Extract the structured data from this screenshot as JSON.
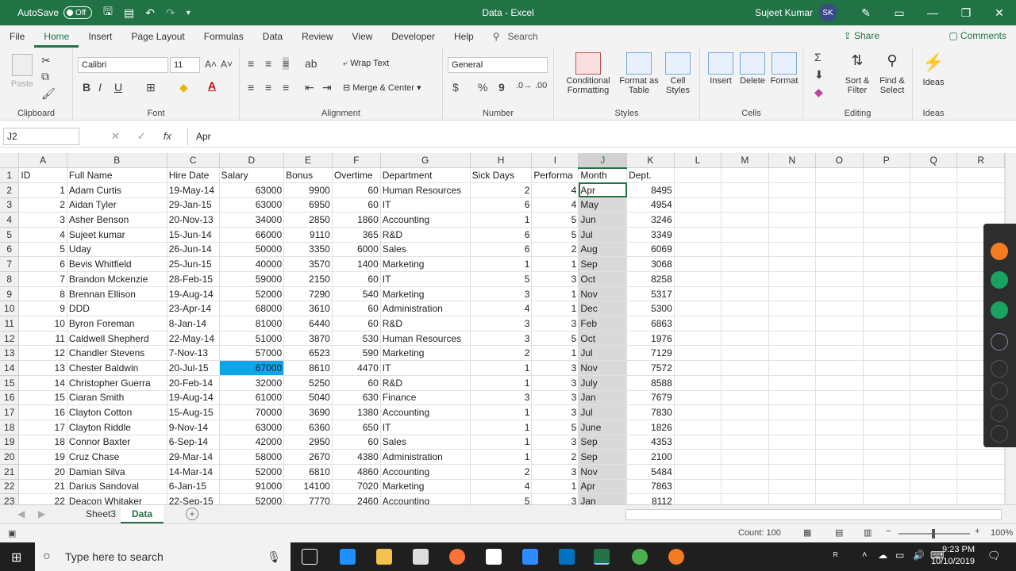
{
  "titlebar": {
    "autosave_label": "AutoSave",
    "autosave_state": "Off",
    "title": "Data - Excel",
    "user_name": "Sujeet Kumar",
    "user_initials": "SK"
  },
  "tabs": [
    "File",
    "Home",
    "Insert",
    "Page Layout",
    "Formulas",
    "Data",
    "Review",
    "View",
    "Developer",
    "Help"
  ],
  "active_tab": "Home",
  "search_label": "Search",
  "share_label": "Share",
  "comments_label": "Comments",
  "ribbon": {
    "clipboard": {
      "paste": "Paste",
      "label": "Clipboard"
    },
    "font": {
      "name": "Calibri",
      "size": "11",
      "bold": "B",
      "italic": "I",
      "underline": "U",
      "label": "Font"
    },
    "alignment": {
      "wrap": "Wrap Text",
      "merge": "Merge & Center",
      "label": "Alignment"
    },
    "number": {
      "format": "General",
      "currency": "$",
      "percent": "%",
      "comma": "9",
      "label": "Number"
    },
    "styles": {
      "conditional": "Conditional",
      "conditional2": "Formatting",
      "format_as": "Format as",
      "format_as2": "Table",
      "cell": "Cell",
      "cell2": "Styles",
      "label": "Styles"
    },
    "cells": {
      "insert": "Insert",
      "delete": "Delete",
      "format": "Format",
      "label": "Cells"
    },
    "editing": {
      "sort": "Sort &",
      "sort2": "Filter",
      "find": "Find &",
      "find2": "Select",
      "label": "Editing"
    },
    "ideas": {
      "ideas": "Ideas",
      "label": "Ideas"
    }
  },
  "formula_bar": {
    "name_box": "J2",
    "fx": "fx",
    "value": "Apr"
  },
  "columns": [
    "A",
    "B",
    "C",
    "D",
    "E",
    "F",
    "G",
    "H",
    "I",
    "J",
    "K",
    "L",
    "M",
    "N",
    "O",
    "P",
    "Q",
    "R"
  ],
  "headers": [
    "ID",
    "Full Name",
    "Hire Date",
    "Salary",
    "Bonus",
    "Overtime",
    "Department",
    "Sick Days",
    "Performa",
    "Month",
    "Dept."
  ],
  "rows": [
    [
      "1",
      "Adam Curtis",
      "19-May-14",
      "63000",
      "9900",
      "60",
      "Human Resources",
      "2",
      "4",
      "Apr",
      "8495"
    ],
    [
      "2",
      "Aidan Tyler",
      "29-Jan-15",
      "63000",
      "6950",
      "60",
      "IT",
      "6",
      "4",
      "May",
      "4954"
    ],
    [
      "3",
      "Asher Benson",
      "20-Nov-13",
      "34000",
      "2850",
      "1860",
      "Accounting",
      "1",
      "5",
      "Jun",
      "3246"
    ],
    [
      "4",
      "Sujeet kumar",
      "15-Jun-14",
      "66000",
      "9110",
      "365",
      "R&D",
      "6",
      "5",
      "Jul",
      "3349"
    ],
    [
      "5",
      "Uday",
      "26-Jun-14",
      "50000",
      "3350",
      "6000",
      "Sales",
      "6",
      "2",
      "Aug",
      "6069"
    ],
    [
      "6",
      "Bevis Whitfield",
      "25-Jun-15",
      "40000",
      "3570",
      "1400",
      "Marketing",
      "1",
      "1",
      "Sep",
      "3068"
    ],
    [
      "7",
      "Brandon Mckenzie",
      "28-Feb-15",
      "59000",
      "2150",
      "60",
      "IT",
      "5",
      "3",
      "Oct",
      "8258"
    ],
    [
      "8",
      "Brennan Ellison",
      "19-Aug-14",
      "52000",
      "7290",
      "540",
      "Marketing",
      "3",
      "1",
      "Nov",
      "5317"
    ],
    [
      "9",
      "DDD",
      "23-Apr-14",
      "68000",
      "3610",
      "60",
      "Administration",
      "4",
      "1",
      "Dec",
      "5300"
    ],
    [
      "10",
      "Byron Foreman",
      "8-Jan-14",
      "81000",
      "6440",
      "60",
      "R&D",
      "3",
      "3",
      "Feb",
      "6863"
    ],
    [
      "11",
      "Caldwell Shepherd",
      "22-May-14",
      "51000",
      "3870",
      "530",
      "Human Resources",
      "3",
      "5",
      "Oct",
      "1976"
    ],
    [
      "12",
      "Chandler Stevens",
      "7-Nov-13",
      "57000",
      "6523",
      "590",
      "Marketing",
      "2",
      "1",
      "Jul",
      "7129"
    ],
    [
      "13",
      "Chester Baldwin",
      "20-Jul-15",
      "67000",
      "8610",
      "4470",
      "IT",
      "1",
      "3",
      "Nov",
      "7572"
    ],
    [
      "14",
      "Christopher Guerra",
      "20-Feb-14",
      "32000",
      "5250",
      "60",
      "R&D",
      "1",
      "3",
      "July",
      "8588"
    ],
    [
      "15",
      "Ciaran Smith",
      "19-Aug-14",
      "61000",
      "5040",
      "630",
      "Finance",
      "3",
      "3",
      "Jan",
      "7679"
    ],
    [
      "16",
      "Clayton Cotton",
      "15-Aug-15",
      "70000",
      "3690",
      "1380",
      "Accounting",
      "1",
      "3",
      "Jul",
      "7830"
    ],
    [
      "17",
      "Clayton Riddle",
      "9-Nov-14",
      "63000",
      "6360",
      "650",
      "IT",
      "1",
      "5",
      "June",
      "1826"
    ],
    [
      "18",
      "Connor Baxter",
      "6-Sep-14",
      "42000",
      "2950",
      "60",
      "Sales",
      "1",
      "3",
      "Sep",
      "4353"
    ],
    [
      "19",
      "Cruz Chase",
      "29-Mar-14",
      "58000",
      "2670",
      "4380",
      "Administration",
      "1",
      "2",
      "Sep",
      "2100"
    ],
    [
      "20",
      "Damian Silva",
      "14-Mar-14",
      "52000",
      "6810",
      "4860",
      "Accounting",
      "2",
      "3",
      "Nov",
      "5484"
    ],
    [
      "21",
      "Darius Sandoval",
      "6-Jan-15",
      "91000",
      "14100",
      "7020",
      "Marketing",
      "4",
      "1",
      "Apr",
      "7863"
    ],
    [
      "22",
      "Deacon Whitaker",
      "22-Sep-15",
      "52000",
      "7770",
      "2460",
      "Accounting",
      "5",
      "3",
      "Jan",
      "8112"
    ]
  ],
  "sheets": [
    "Sheet3",
    "Data"
  ],
  "active_sheet": "Data",
  "status": {
    "count": "Count: 100",
    "zoom": "100%"
  },
  "taskbar": {
    "search_placeholder": "Type here to search",
    "time": "9:23 PM",
    "date": "10/10/2019"
  },
  "colors": {
    "excel_green": "#217346",
    "highlight": "#0ea5e9",
    "selection": "#d9d9d9"
  }
}
